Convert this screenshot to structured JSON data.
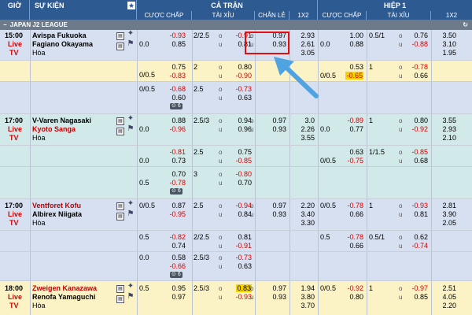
{
  "header": {
    "time": "GIỜ",
    "event": "SỰ KIỆN",
    "fulltime": "CẢ TRẬN",
    "firsthalf": "HIỆP 1",
    "handicap": "CƯỢC CHẤP",
    "overunder": "TÀI XỈU",
    "oddeven": "CHẴN LẺ",
    "x12": "1X2",
    "handicap_h1": "CƯỢC CHẤP",
    "overunder_h1": "TÀI XỈU",
    "x12_h1": "1X2"
  },
  "league": {
    "name": "JAPAN J2 LEAGUE"
  },
  "o": "o",
  "u": "u",
  "draw": "Hòa",
  "live": "Live",
  "tv": "TV",
  "badge6": "6",
  "m1": {
    "time": "15:00",
    "home": "Avispa Fukuoka",
    "away": "Fagiano Okayama",
    "r1": {
      "hc": "",
      "a": "-0.93",
      "b": "0.85",
      "ou": "2/2.5",
      "c": "-0.91",
      "d": "0.81",
      "oe1": "0.97",
      "oe2": "0.93",
      "x1": "2.93",
      "x2": "2.61",
      "x3": "3.05",
      "hhc": "0.0",
      "h1": "1.00",
      "h2": "0.88",
      "hou": "0.5/1",
      "h3": "0.76",
      "h4": "-0.88",
      "hx1": "3.50",
      "hx2": "3.10",
      "hx3": "1.95",
      "hcb": "0.0"
    },
    "r2": {
      "hc": "0/0.5",
      "a": "0.75",
      "b": "-0.83",
      "ou": "2",
      "c": "0.80",
      "d": "-0.90",
      "hhc": "0/0.5",
      "h1": "0.53",
      "h2": "-0.65",
      "hou": "1",
      "h3": "-0.78",
      "h4": "0.66"
    },
    "r3": {
      "hc": "0/0.5",
      "a": "-0.68",
      "b": "0.60",
      "ou": "2.5",
      "c": "-0.73",
      "d": "0.63"
    }
  },
  "m2": {
    "time": "17:00",
    "home": "V-Varen Nagasaki",
    "away": "Kyoto Sanga",
    "r1": {
      "hc": "0.0",
      "a": "0.88",
      "b": "-0.96",
      "ou": "2.5/3",
      "c": "0.94",
      "d": "0.96",
      "oe1": "0.97",
      "oe2": "0.93",
      "x1": "3.0",
      "x2": "2.26",
      "x3": "3.55",
      "hhc": "0.0",
      "h1": "-0.89",
      "h2": "0.77",
      "hou": "1",
      "h3": "0.80",
      "h4": "-0.92",
      "hx1": "3.55",
      "hx2": "2.93",
      "hx3": "2.10"
    },
    "r2": {
      "hc": "0.0",
      "a": "-0.81",
      "b": "0.73",
      "ou": "2.5",
      "c": "0.75",
      "d": "-0.85",
      "hhc": "0/0.5",
      "h1": "0.63",
      "h2": "-0.75",
      "hou": "1/1.5",
      "h3": "-0.85",
      "h4": "0.68"
    },
    "r3": {
      "hc": "0.5",
      "a": "0.70",
      "b": "-0.78",
      "ou": "3",
      "c": "-0.80",
      "d": "0.70"
    }
  },
  "m3": {
    "time": "17:00",
    "home": "Ventforet Kofu",
    "away": "Albirex Niigata",
    "r1": {
      "hc": "0/0.5",
      "a": "0.87",
      "b": "-0.95",
      "ou": "2.5",
      "c": "-0.94",
      "d": "0.84",
      "oe1": "0.97",
      "oe2": "0.93",
      "x1": "2.20",
      "x2": "3.40",
      "x3": "3.30",
      "hhc": "0/0.5",
      "h1": "-0.78",
      "h2": "0.66",
      "hou": "1",
      "h3": "-0.93",
      "h4": "0.81",
      "hx1": "2.81",
      "hx2": "3.90",
      "hx3": "2.05"
    },
    "r2": {
      "hc": "0.5",
      "a": "-0.82",
      "b": "0.74",
      "ou": "2/2.5",
      "c": "0.81",
      "d": "-0.91",
      "hhc": "0.5",
      "h1": "-0.78",
      "h2": "0.66",
      "hou": "0.5/1",
      "h3": "0.62",
      "h4": "-0.74"
    },
    "r3": {
      "hc": "0.0",
      "a": "0.58",
      "b": "-0.66",
      "ou": "2.5/3",
      "c": "-0.73",
      "d": "0.63"
    }
  },
  "m4": {
    "time": "18:00",
    "home": "Zweigen Kanazawa",
    "away": "Renofa Yamaguchi",
    "r1": {
      "hc": "0.5",
      "a": "0.95",
      "b": "0.97",
      "ou": "2.5/3",
      "c": "0.83",
      "d": "-0.93",
      "oe1": "0.97",
      "oe2": "0.93",
      "x1": "1.94",
      "x2": "3.80",
      "x3": "3.70",
      "hhc": "0/0.5",
      "h1": "-0.92",
      "h2": "0.80",
      "hou": "1",
      "h3": "-0.97",
      "h4": "0.85",
      "hx1": "2.51",
      "hx2": "4.05",
      "hx3": "2.20"
    }
  },
  "colors": {
    "header": "#2e5a92",
    "negative": "#d40000",
    "highlight": "#f5d200",
    "arrow": "#4fa3e0",
    "box": "#e01010"
  }
}
